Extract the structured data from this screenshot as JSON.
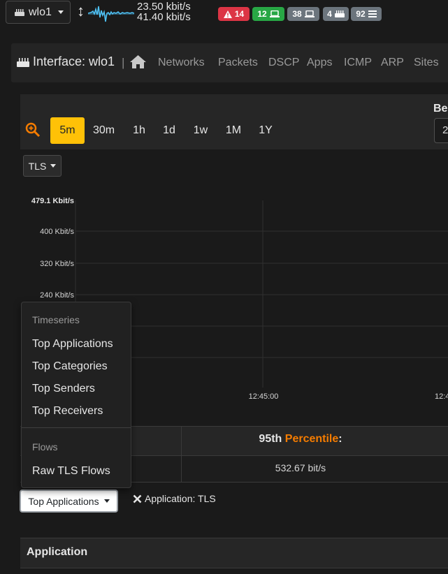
{
  "topbar": {
    "interface_name": "wlo1",
    "rate_up": "23.50 kbit/s",
    "rate_down": "41.40 kbit/s",
    "badges": [
      {
        "label": "14",
        "icon": "warning-icon",
        "color": "#dc3545"
      },
      {
        "label": "12",
        "icon": "laptop-icon",
        "color": "#28a745"
      },
      {
        "label": "38",
        "icon": "laptop-icon",
        "color": "#6c757d"
      },
      {
        "label": "4",
        "icon": "router-icon",
        "color": "#6c757d"
      },
      {
        "label": "92",
        "icon": "list-icon",
        "color": "#6c757d"
      }
    ]
  },
  "nav": {
    "title": "Interface: wlo1",
    "separator": "|",
    "items": [
      "Networks",
      "Packets",
      "DSCP",
      "Apps",
      "ICMP",
      "ARP",
      "Sites"
    ]
  },
  "timeframe": {
    "buttons": [
      "5m",
      "30m",
      "1h",
      "1d",
      "1w",
      "1M",
      "1Y"
    ],
    "active": "5m",
    "begin_label": "Be",
    "begin_value": "2"
  },
  "metric_selector": {
    "label": "TLS"
  },
  "chart_data": {
    "type": "line",
    "y_ticks": [
      "479.1 Kbit/s",
      "400 Kbit/s",
      "320 Kbit/s",
      "240 Kbit/s"
    ],
    "x_ticks": [
      "12:45:00",
      "12:4"
    ],
    "grid": true,
    "series": []
  },
  "stats": {
    "percentile_prefix": "95th ",
    "percentile_accent": "Percentile",
    "percentile_suffix": ":",
    "percentile_value": "532.67 bit/s"
  },
  "dropdown": {
    "timeseries_header": "Timeseries",
    "timeseries_items": [
      "Top Applications",
      "Top Categories",
      "Top Senders",
      "Top Receivers"
    ],
    "flows_header": "Flows",
    "flows_items": [
      "Raw TLS Flows"
    ]
  },
  "bottom": {
    "selector_label": "Top Applications",
    "filter_label": "Application: TLS",
    "table_header": "Application"
  },
  "colors": {
    "accent": "#ffc107",
    "percentile": "#f57c00",
    "zoom_icon": "#f57c00",
    "sparkline": "#4fc3f7"
  }
}
